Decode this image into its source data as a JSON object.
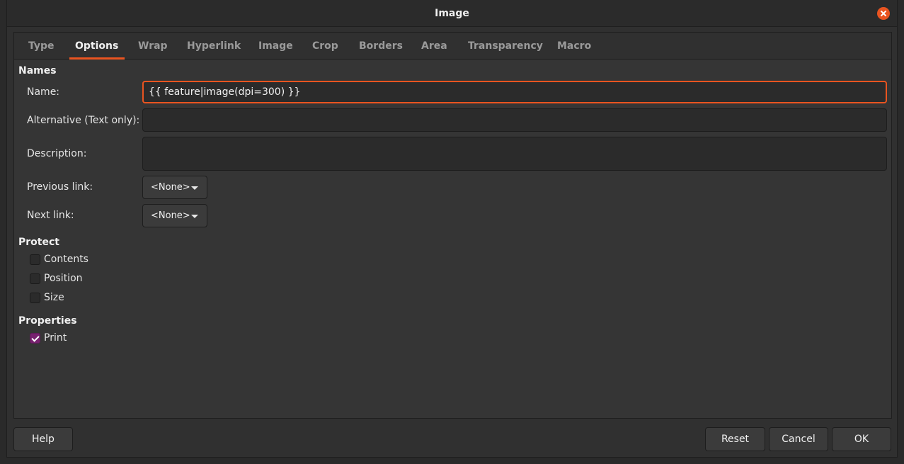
{
  "window": {
    "title": "Image"
  },
  "tabs": [
    {
      "label": "Type"
    },
    {
      "label": "Options"
    },
    {
      "label": "Wrap"
    },
    {
      "label": "Hyperlink"
    },
    {
      "label": "Image"
    },
    {
      "label": "Crop"
    },
    {
      "label": "Borders"
    },
    {
      "label": "Area"
    },
    {
      "label": "Transparency"
    },
    {
      "label": "Macro"
    }
  ],
  "active_tab": "Options",
  "names": {
    "heading": "Names",
    "name_label": "Name:",
    "name_value": "{{ feature|image(dpi=300) }}",
    "alt_label": "Alternative (Text only):",
    "alt_value": "",
    "desc_label": "Description:",
    "desc_value": "",
    "prev_label": "Previous link:",
    "prev_value": "<None>",
    "next_label": "Next link:",
    "next_value": "<None>"
  },
  "protect": {
    "heading": "Protect",
    "items": [
      {
        "label": "Contents",
        "checked": false
      },
      {
        "label": "Position",
        "checked": false
      },
      {
        "label": "Size",
        "checked": false
      }
    ]
  },
  "properties": {
    "heading": "Properties",
    "items": [
      {
        "label": "Print",
        "checked": true
      }
    ]
  },
  "buttons": {
    "help": "Help",
    "reset": "Reset",
    "cancel": "Cancel",
    "ok": "OK"
  },
  "colors": {
    "accent": "#e95420",
    "checkbox_checked": "#77216f",
    "background": "#353535"
  }
}
